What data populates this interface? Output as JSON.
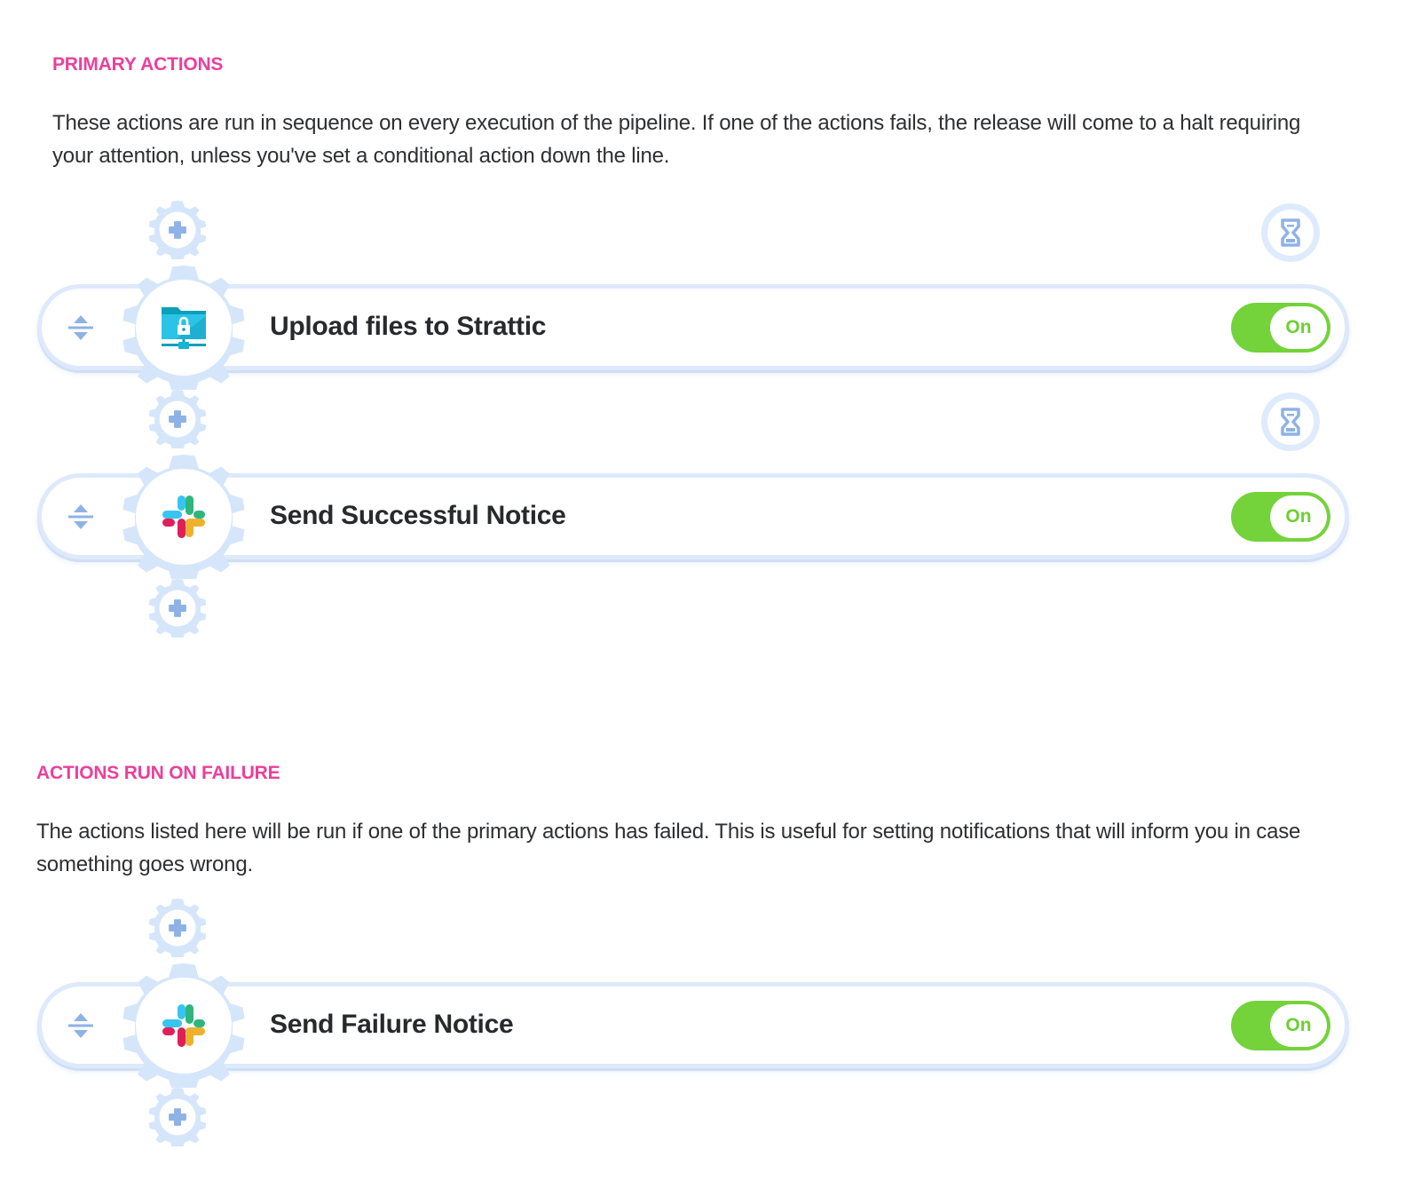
{
  "primary": {
    "heading": "PRIMARY ACTIONS",
    "description": "These actions are run in sequence on every execution of the pipeline. If one of the actions fails, the release will come to a halt requiring your attention, unless you've set a conditional action down the line.",
    "actions": [
      {
        "title": "Upload files to Strattic",
        "icon": "secure-folder-network-icon",
        "toggle_label": "On",
        "enabled": true
      },
      {
        "title": "Send Successful Notice",
        "icon": "slack-icon",
        "toggle_label": "On",
        "enabled": true
      }
    ]
  },
  "failure": {
    "heading": "ACTIONS RUN ON FAILURE",
    "description": "The actions listed here will be run if one of the primary actions has failed. This is useful for setting notifications that will inform you in case something goes wrong.",
    "actions": [
      {
        "title": "Send Failure Notice",
        "icon": "slack-icon",
        "toggle_label": "On",
        "enabled": true
      }
    ]
  },
  "colors": {
    "heading": "#ec3f9b",
    "toggle_on": "#74d23a",
    "gear": "#d5e6fb",
    "icon_accent": "#8fb2e6"
  }
}
